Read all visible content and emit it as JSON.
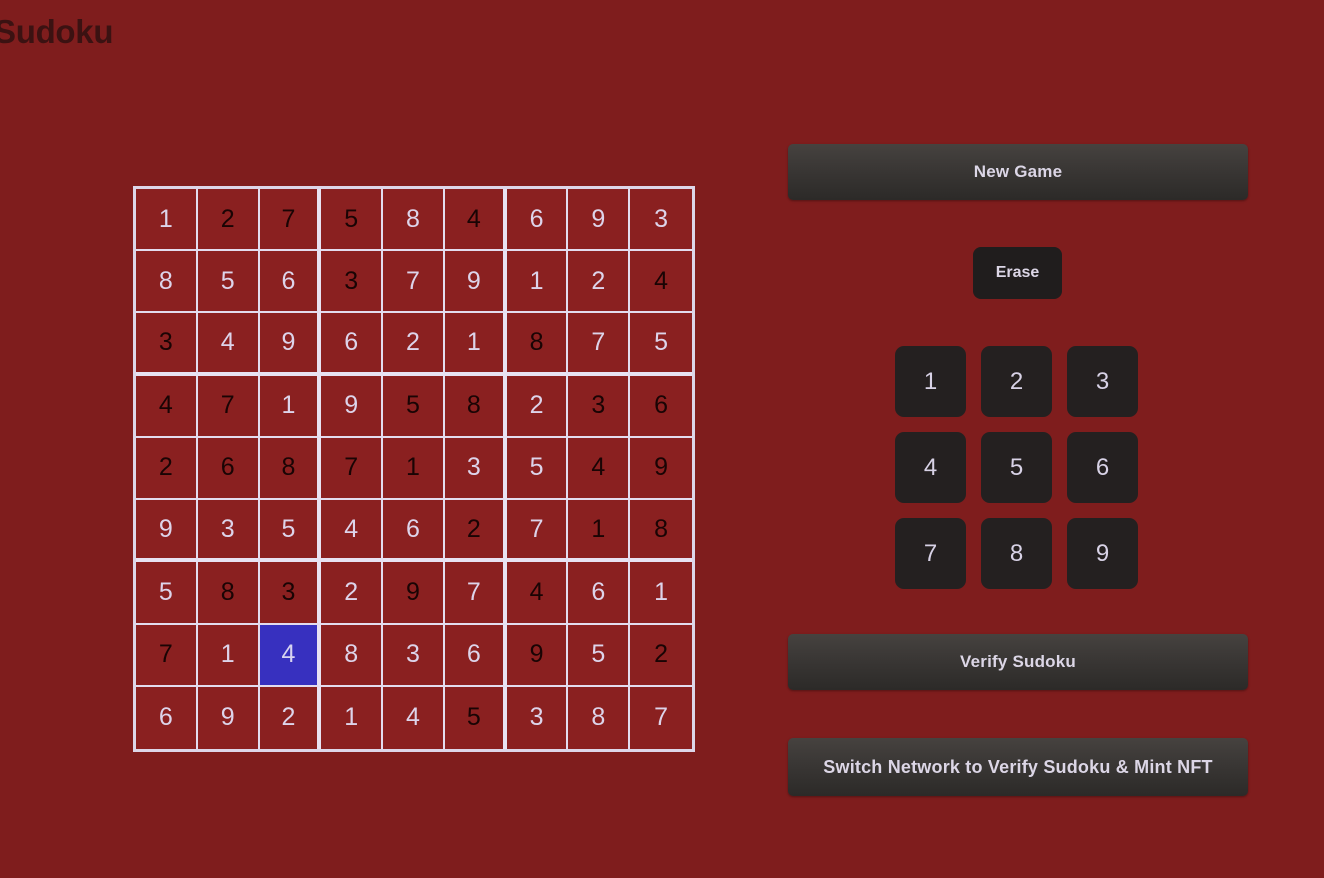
{
  "app": {
    "title": "Sudoku",
    "background_color": "#7f1d1d",
    "title_color": "#3b1212"
  },
  "board": {
    "selected_cell": {
      "row": 7,
      "col": 2,
      "value": "4",
      "color": "#3730bf"
    },
    "given_color": "#ddd4ea",
    "entered_color": "#190404",
    "grid_line_color": "#ddd6e8",
    "rows": [
      [
        {
          "value": "1",
          "style": "given"
        },
        {
          "value": "2",
          "style": "entered"
        },
        {
          "value": "7",
          "style": "entered"
        },
        {
          "value": "5",
          "style": "entered"
        },
        {
          "value": "8",
          "style": "given"
        },
        {
          "value": "4",
          "style": "entered"
        },
        {
          "value": "6",
          "style": "given"
        },
        {
          "value": "9",
          "style": "given"
        },
        {
          "value": "3",
          "style": "given"
        }
      ],
      [
        {
          "value": "8",
          "style": "given"
        },
        {
          "value": "5",
          "style": "given"
        },
        {
          "value": "6",
          "style": "given"
        },
        {
          "value": "3",
          "style": "entered"
        },
        {
          "value": "7",
          "style": "given"
        },
        {
          "value": "9",
          "style": "given"
        },
        {
          "value": "1",
          "style": "given"
        },
        {
          "value": "2",
          "style": "given"
        },
        {
          "value": "4",
          "style": "entered"
        }
      ],
      [
        {
          "value": "3",
          "style": "entered"
        },
        {
          "value": "4",
          "style": "given"
        },
        {
          "value": "9",
          "style": "given"
        },
        {
          "value": "6",
          "style": "given"
        },
        {
          "value": "2",
          "style": "given"
        },
        {
          "value": "1",
          "style": "given"
        },
        {
          "value": "8",
          "style": "entered"
        },
        {
          "value": "7",
          "style": "given"
        },
        {
          "value": "5",
          "style": "given"
        }
      ],
      [
        {
          "value": "4",
          "style": "entered"
        },
        {
          "value": "7",
          "style": "entered"
        },
        {
          "value": "1",
          "style": "given"
        },
        {
          "value": "9",
          "style": "given"
        },
        {
          "value": "5",
          "style": "entered"
        },
        {
          "value": "8",
          "style": "entered"
        },
        {
          "value": "2",
          "style": "given"
        },
        {
          "value": "3",
          "style": "entered"
        },
        {
          "value": "6",
          "style": "entered"
        }
      ],
      [
        {
          "value": "2",
          "style": "entered"
        },
        {
          "value": "6",
          "style": "entered"
        },
        {
          "value": "8",
          "style": "entered"
        },
        {
          "value": "7",
          "style": "entered"
        },
        {
          "value": "1",
          "style": "entered"
        },
        {
          "value": "3",
          "style": "given"
        },
        {
          "value": "5",
          "style": "given"
        },
        {
          "value": "4",
          "style": "entered"
        },
        {
          "value": "9",
          "style": "entered"
        }
      ],
      [
        {
          "value": "9",
          "style": "given"
        },
        {
          "value": "3",
          "style": "given"
        },
        {
          "value": "5",
          "style": "given"
        },
        {
          "value": "4",
          "style": "given"
        },
        {
          "value": "6",
          "style": "given"
        },
        {
          "value": "2",
          "style": "entered"
        },
        {
          "value": "7",
          "style": "given"
        },
        {
          "value": "1",
          "style": "entered"
        },
        {
          "value": "8",
          "style": "entered"
        }
      ],
      [
        {
          "value": "5",
          "style": "given"
        },
        {
          "value": "8",
          "style": "entered"
        },
        {
          "value": "3",
          "style": "entered"
        },
        {
          "value": "2",
          "style": "given"
        },
        {
          "value": "9",
          "style": "entered"
        },
        {
          "value": "7",
          "style": "given"
        },
        {
          "value": "4",
          "style": "entered"
        },
        {
          "value": "6",
          "style": "given"
        },
        {
          "value": "1",
          "style": "given"
        }
      ],
      [
        {
          "value": "7",
          "style": "entered"
        },
        {
          "value": "1",
          "style": "given"
        },
        {
          "value": "4",
          "style": "selected"
        },
        {
          "value": "8",
          "style": "given"
        },
        {
          "value": "3",
          "style": "given"
        },
        {
          "value": "6",
          "style": "given"
        },
        {
          "value": "9",
          "style": "entered"
        },
        {
          "value": "5",
          "style": "given"
        },
        {
          "value": "2",
          "style": "entered"
        }
      ],
      [
        {
          "value": "6",
          "style": "given"
        },
        {
          "value": "9",
          "style": "given"
        },
        {
          "value": "2",
          "style": "given"
        },
        {
          "value": "1",
          "style": "given"
        },
        {
          "value": "4",
          "style": "given"
        },
        {
          "value": "5",
          "style": "entered"
        },
        {
          "value": "3",
          "style": "given"
        },
        {
          "value": "8",
          "style": "given"
        },
        {
          "value": "7",
          "style": "given"
        }
      ]
    ]
  },
  "panel": {
    "new_game_label": "New Game",
    "erase_label": "Erase",
    "numpad_keys": [
      "1",
      "2",
      "3",
      "4",
      "5",
      "6",
      "7",
      "8",
      "9"
    ],
    "verify_label": "Verify Sudoku",
    "switch_network_label": "Switch Network to Verify Sudoku & Mint NFT"
  }
}
